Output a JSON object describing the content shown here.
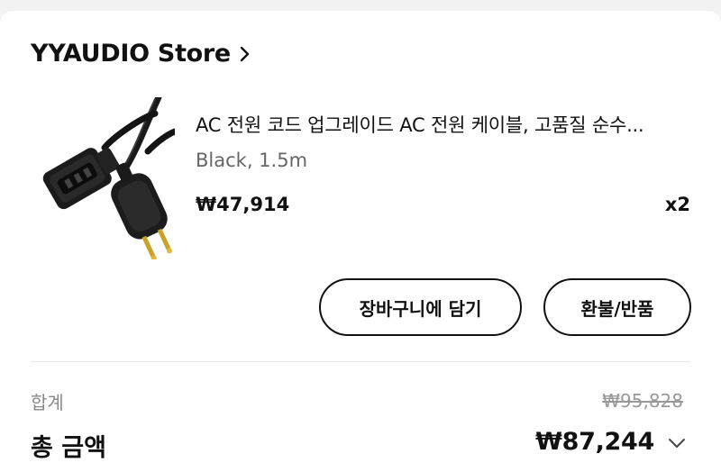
{
  "store": {
    "name": "YYAUDIO Store",
    "chevron_icon": "chevron-right-icon"
  },
  "product": {
    "image_icon": "power-cable-image",
    "title": "AC 전원 코드 업그레이드 AC 전원 케이블, 고품질 순수...",
    "option": "Black, 1.5m",
    "price": "₩47,914",
    "quantity": "x2"
  },
  "actions": {
    "add_to_cart_label": "장바구니에 담기",
    "refund_return_label": "환불/반품"
  },
  "summary": {
    "subtotal_label": "합계",
    "subtotal_value": "₩95,828",
    "total_label": "총 금액",
    "total_value": "₩87,244",
    "expand_icon": "chevron-down-icon"
  }
}
